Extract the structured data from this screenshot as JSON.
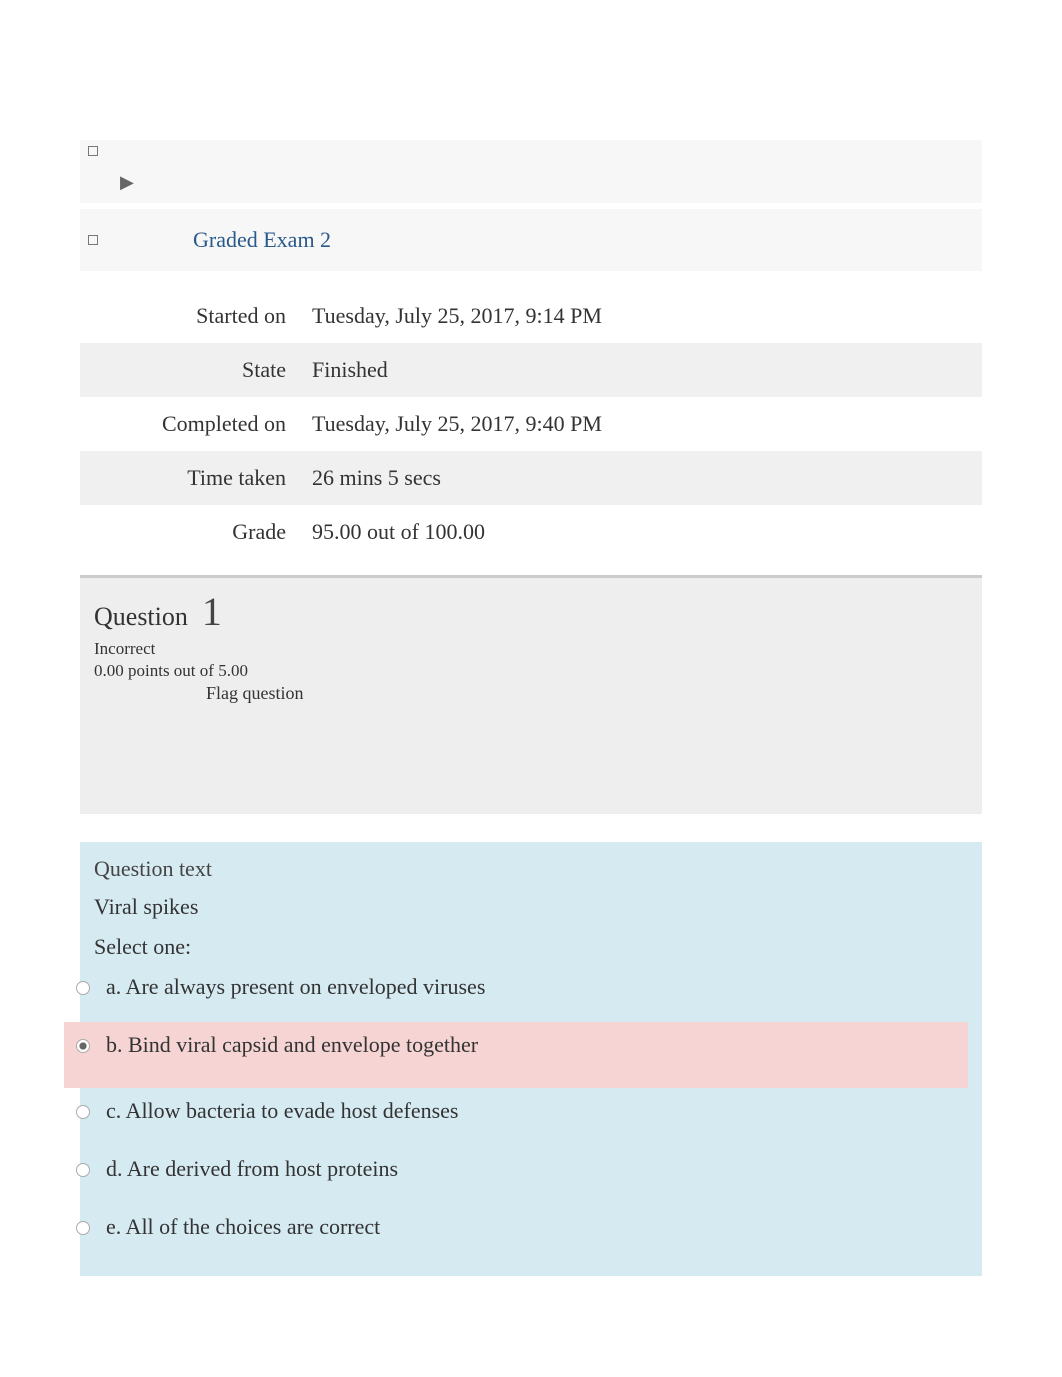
{
  "breadcrumb": {
    "arrow": "▶",
    "link": "Graded Exam 2"
  },
  "summary": {
    "started_label": "Started on",
    "started_value": "Tuesday, July 25, 2017, 9:14 PM",
    "state_label": "State",
    "state_value": "Finished",
    "completed_label": "Completed on",
    "completed_value": "Tuesday, July 25, 2017, 9:40 PM",
    "time_label": "Time taken",
    "time_value": "26 mins 5 secs",
    "grade_label": "Grade",
    "grade_value": "95.00 out of 100.00"
  },
  "question": {
    "label": "Question",
    "number": "1",
    "status": "Incorrect",
    "points": "0.00 points out of 5.00",
    "flag": "Flag question",
    "text_heading": "Question text",
    "prompt": "Viral spikes",
    "select_one": "Select one:",
    "options": {
      "a": "a. Are always present on enveloped viruses",
      "b": "b. Bind viral capsid and envelope together",
      "c": "c. Allow bacteria to evade host defenses",
      "d": "d. Are derived from host proteins",
      "e": "e. All of the choices are correct"
    }
  }
}
